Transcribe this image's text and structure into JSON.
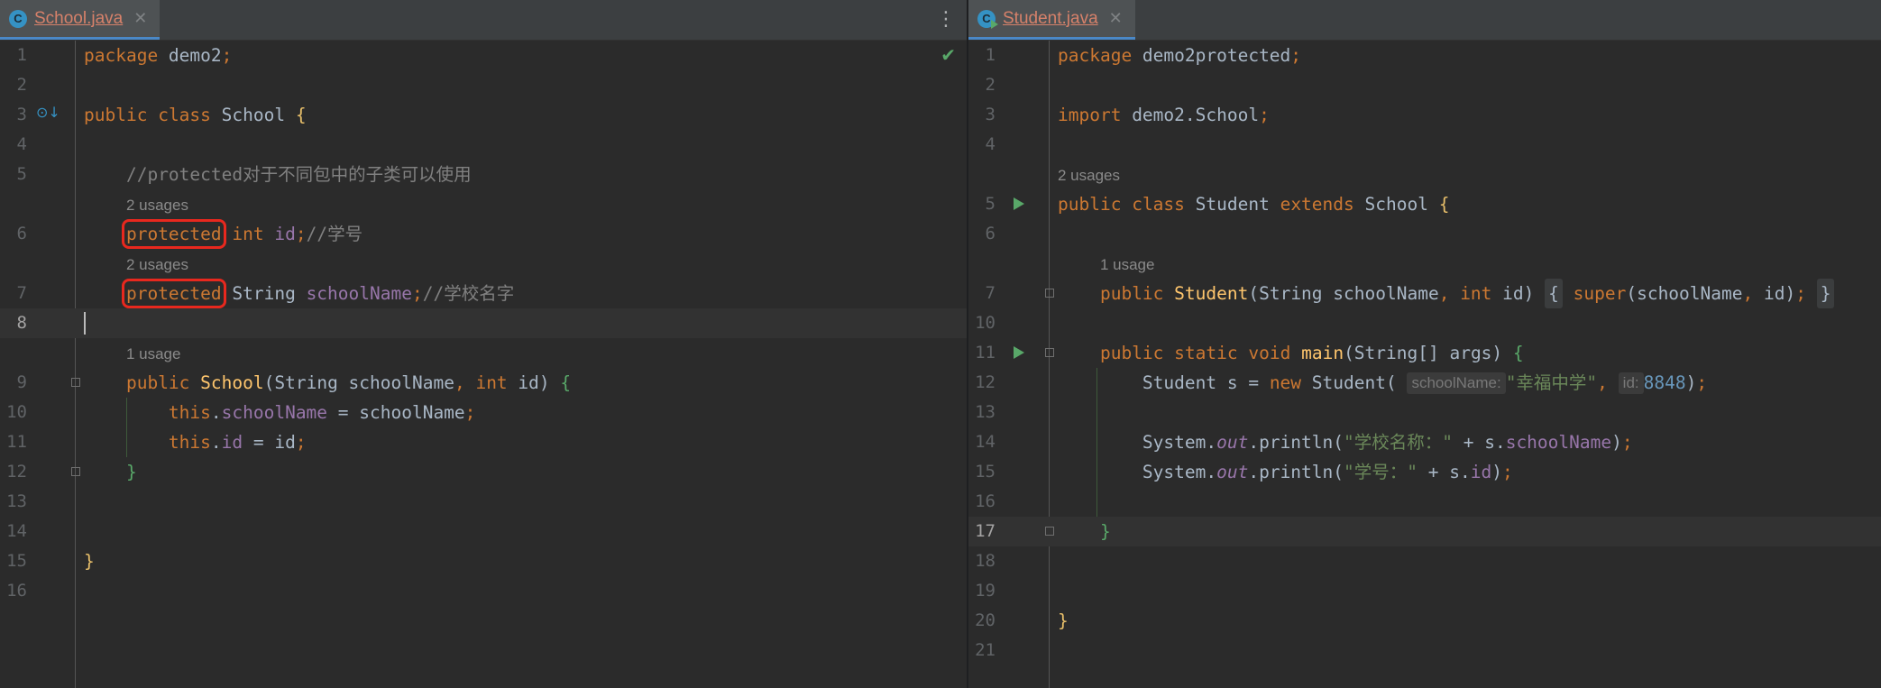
{
  "left_editor": {
    "tab": {
      "file_name": "School.java",
      "icon_letter": "C"
    },
    "lines": {
      "l1": {
        "num": "1",
        "kw": "package",
        "pkg": " demo2",
        "semi": ";"
      },
      "l2": {
        "num": "2"
      },
      "l3": {
        "num": "3",
        "kw1": "public",
        "kw2": "class",
        "name": " School ",
        "brace": "{"
      },
      "l4": {
        "num": "4"
      },
      "l5": {
        "num": "5",
        "comment": "//protected对于不同包中的子类可以使用"
      },
      "u6": "2 usages",
      "l6": {
        "num": "6",
        "kw1": "protected",
        "kw2": "int",
        "field": "id",
        "semi": ";",
        "comment": "//学号"
      },
      "u7": "2 usages",
      "l7": {
        "num": "7",
        "kw1": "protected",
        "type": " String ",
        "field": "schoolName",
        "semi": ";",
        "comment": "//学校名字"
      },
      "l8": {
        "num": "8"
      },
      "u9": "1 usage",
      "l9": {
        "num": "9",
        "kw1": "public",
        "meth": "School",
        "p1": "(String schoolName",
        "comma": ",",
        "kw2": "int",
        "p2": " id) ",
        "brace": "{"
      },
      "l10": {
        "num": "10",
        "kw": "this",
        "dot": ".",
        "field": "schoolName",
        "rest": " = schoolName",
        "semi": ";"
      },
      "l11": {
        "num": "11",
        "kw": "this",
        "dot": ".",
        "field": "id",
        "rest": " = id",
        "semi": ";"
      },
      "l12": {
        "num": "12",
        "brace": "}"
      },
      "l13": {
        "num": "13"
      },
      "l14": {
        "num": "14"
      },
      "l15": {
        "num": "15",
        "brace": "}"
      },
      "l16": {
        "num": "16"
      }
    }
  },
  "right_editor": {
    "tab": {
      "file_name": "Student.java",
      "icon_letter": "C"
    },
    "lines": {
      "r1": {
        "num": "1",
        "kw": "package",
        "pkg": " demo2protected",
        "semi": ";"
      },
      "r2": {
        "num": "2"
      },
      "r3": {
        "num": "3",
        "kw": "import",
        "pkg": " demo2.School",
        "semi": ";"
      },
      "r4": {
        "num": "4"
      },
      "u5": "2 usages",
      "r5": {
        "num": "5",
        "kw1": "public",
        "kw2": "class",
        "name": " Student ",
        "kw3": "extends",
        "parent": " School ",
        "brace": "{"
      },
      "r6": {
        "num": "6"
      },
      "u7": "1 usage",
      "r7": {
        "num": "7",
        "kw1": "public",
        "meth": "Student",
        "p1": "(String schoolName",
        "comma": ",",
        "kw2": "int",
        "p2": " id)",
        "open": "{",
        "kw3": "super",
        "args1": "(schoolName",
        "comma2": ",",
        "args2": " id)",
        "semi": ";",
        "close": "}"
      },
      "r10": {
        "num": "10"
      },
      "r11": {
        "num": "11",
        "kw1": "public",
        "kw2": "static",
        "kw3": "void",
        "meth": "main",
        "params": "(String[] args) ",
        "brace": "{"
      },
      "r12": {
        "num": "12",
        "pre": "Student s = ",
        "kw": "new",
        "ctor": " Student(",
        "hint1": "schoolName:",
        "str": "\"幸福中学\"",
        "comma": ",",
        "hint2": "id:",
        "num_val": "8848",
        "close": ")",
        "semi": ";"
      },
      "r13": {
        "num": "13"
      },
      "r14": {
        "num": "14",
        "sys": "System.",
        "out": "out",
        "call": ".println(",
        "str": "\"学校名称：\"",
        "plus": " + s.",
        "field": "schoolName",
        "close": ")",
        "semi": ";"
      },
      "r15": {
        "num": "15",
        "sys": "System.",
        "out": "out",
        "call": ".println(",
        "str": "\"学号：\"",
        "plus": " + s.",
        "field": "id",
        "close": ")",
        "semi": ";"
      },
      "r16": {
        "num": "16"
      },
      "r17": {
        "num": "17",
        "brace": "}"
      },
      "r18": {
        "num": "18"
      },
      "r19": {
        "num": "19"
      },
      "r20": {
        "num": "20",
        "brace": "}"
      },
      "r21": {
        "num": "21"
      }
    }
  },
  "colors": {
    "keyword": "#cc7832",
    "field": "#9876aa",
    "comment": "#808080",
    "string": "#6a8759",
    "number": "#6897bb",
    "method": "#ffc66d",
    "highlight_box": "#e8281e"
  },
  "icons": [
    "class-file-icon",
    "close-icon",
    "more-options-icon",
    "check-icon",
    "implemented-icon",
    "run-icon",
    "fold-icon"
  ]
}
